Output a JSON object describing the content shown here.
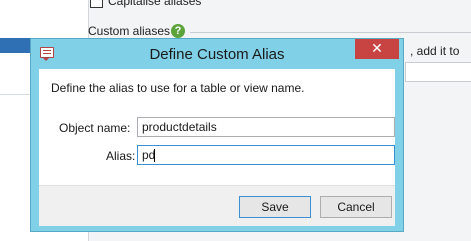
{
  "background": {
    "checkbox_label": "Capitalise aliases",
    "group_label": "Custom aliases",
    "help_icon": "?",
    "right_text": ", add it to"
  },
  "dialog": {
    "title": "Define Custom Alias",
    "close_glyph": "✕",
    "instruction": "Define the alias to use for a table or view name.",
    "object_name_label": "Object name:",
    "object_name_value": "productdetails",
    "alias_label": "Alias:",
    "alias_value": "pd",
    "save_label": "Save",
    "cancel_label": "Cancel"
  },
  "colors": {
    "dialog_frame": "#80d1e8",
    "close_button": "#c74443",
    "focus_border": "#3c8fd4",
    "help_icon": "#5ba33a"
  }
}
